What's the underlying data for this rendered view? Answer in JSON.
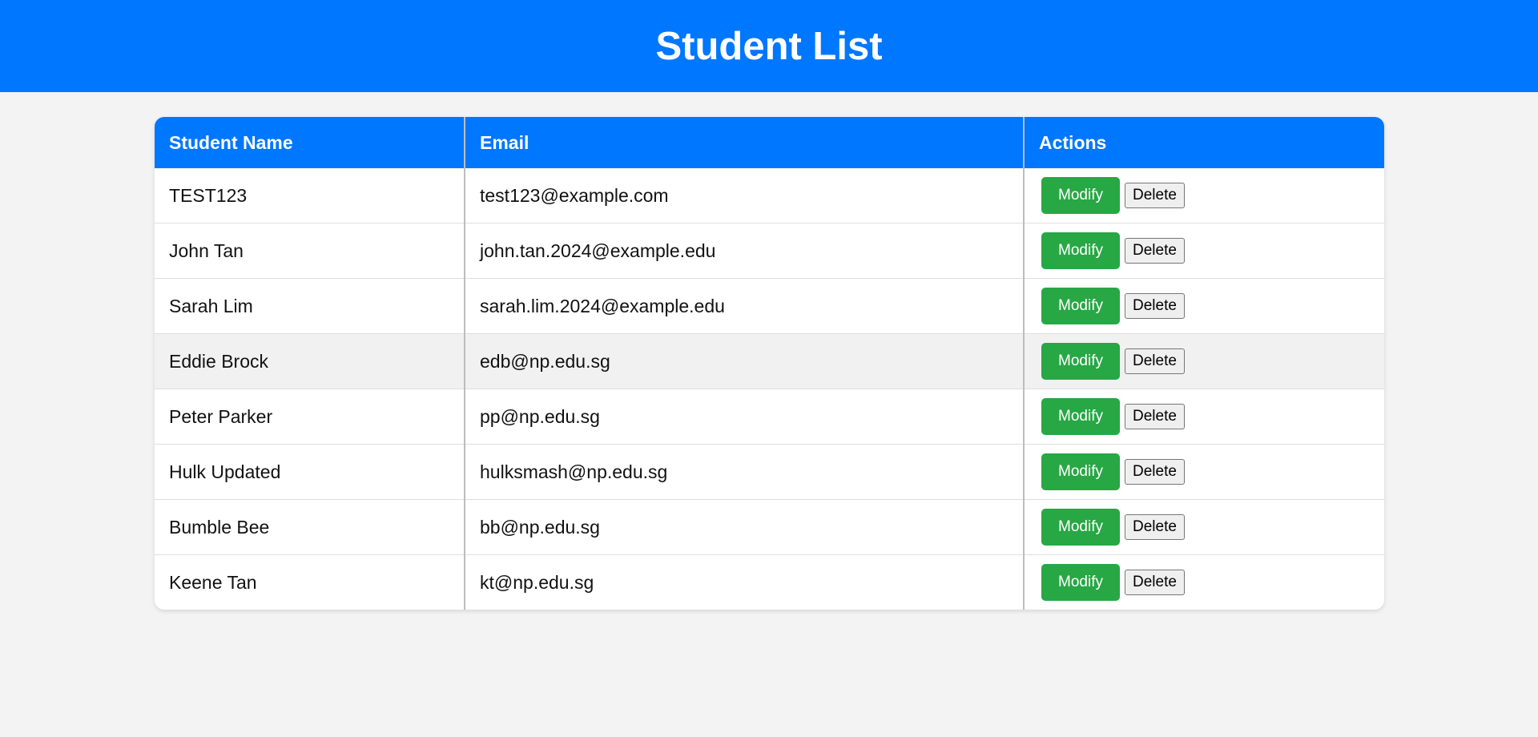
{
  "header": {
    "title": "Student List"
  },
  "table": {
    "columns": [
      "Student Name",
      "Email",
      "Actions"
    ],
    "rows": [
      {
        "name": "TEST123",
        "email": "test123@example.com"
      },
      {
        "name": "John Tan",
        "email": "john.tan.2024@example.edu"
      },
      {
        "name": "Sarah Lim",
        "email": "sarah.lim.2024@example.edu"
      },
      {
        "name": "Eddie Brock",
        "email": "edb@np.edu.sg"
      },
      {
        "name": "Peter Parker",
        "email": "pp@np.edu.sg"
      },
      {
        "name": "Hulk Updated",
        "email": "hulksmash@np.edu.sg"
      },
      {
        "name": "Bumble Bee",
        "email": "bb@np.edu.sg"
      },
      {
        "name": "Keene Tan",
        "email": "kt@np.edu.sg"
      }
    ],
    "modify_label": "Modify",
    "delete_label": "Delete"
  },
  "colors": {
    "header_bg": "#0077ff",
    "modify_bg": "#28a745",
    "page_bg": "#f3f3f3"
  }
}
